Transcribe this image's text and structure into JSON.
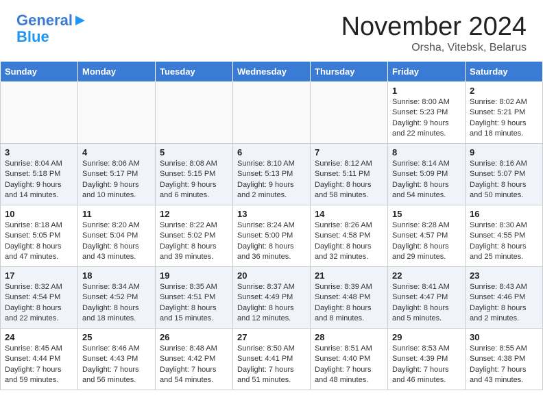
{
  "header": {
    "logo_line1": "General",
    "logo_line2": "Blue",
    "month_title": "November 2024",
    "location": "Orsha, Vitebsk, Belarus"
  },
  "weekdays": [
    "Sunday",
    "Monday",
    "Tuesday",
    "Wednesday",
    "Thursday",
    "Friday",
    "Saturday"
  ],
  "weeks": [
    [
      {
        "day": "",
        "info": ""
      },
      {
        "day": "",
        "info": ""
      },
      {
        "day": "",
        "info": ""
      },
      {
        "day": "",
        "info": ""
      },
      {
        "day": "",
        "info": ""
      },
      {
        "day": "1",
        "info": "Sunrise: 8:00 AM\nSunset: 5:23 PM\nDaylight: 9 hours\nand 22 minutes."
      },
      {
        "day": "2",
        "info": "Sunrise: 8:02 AM\nSunset: 5:21 PM\nDaylight: 9 hours\nand 18 minutes."
      }
    ],
    [
      {
        "day": "3",
        "info": "Sunrise: 8:04 AM\nSunset: 5:18 PM\nDaylight: 9 hours\nand 14 minutes."
      },
      {
        "day": "4",
        "info": "Sunrise: 8:06 AM\nSunset: 5:17 PM\nDaylight: 9 hours\nand 10 minutes."
      },
      {
        "day": "5",
        "info": "Sunrise: 8:08 AM\nSunset: 5:15 PM\nDaylight: 9 hours\nand 6 minutes."
      },
      {
        "day": "6",
        "info": "Sunrise: 8:10 AM\nSunset: 5:13 PM\nDaylight: 9 hours\nand 2 minutes."
      },
      {
        "day": "7",
        "info": "Sunrise: 8:12 AM\nSunset: 5:11 PM\nDaylight: 8 hours\nand 58 minutes."
      },
      {
        "day": "8",
        "info": "Sunrise: 8:14 AM\nSunset: 5:09 PM\nDaylight: 8 hours\nand 54 minutes."
      },
      {
        "day": "9",
        "info": "Sunrise: 8:16 AM\nSunset: 5:07 PM\nDaylight: 8 hours\nand 50 minutes."
      }
    ],
    [
      {
        "day": "10",
        "info": "Sunrise: 8:18 AM\nSunset: 5:05 PM\nDaylight: 8 hours\nand 47 minutes."
      },
      {
        "day": "11",
        "info": "Sunrise: 8:20 AM\nSunset: 5:04 PM\nDaylight: 8 hours\nand 43 minutes."
      },
      {
        "day": "12",
        "info": "Sunrise: 8:22 AM\nSunset: 5:02 PM\nDaylight: 8 hours\nand 39 minutes."
      },
      {
        "day": "13",
        "info": "Sunrise: 8:24 AM\nSunset: 5:00 PM\nDaylight: 8 hours\nand 36 minutes."
      },
      {
        "day": "14",
        "info": "Sunrise: 8:26 AM\nSunset: 4:58 PM\nDaylight: 8 hours\nand 32 minutes."
      },
      {
        "day": "15",
        "info": "Sunrise: 8:28 AM\nSunset: 4:57 PM\nDaylight: 8 hours\nand 29 minutes."
      },
      {
        "day": "16",
        "info": "Sunrise: 8:30 AM\nSunset: 4:55 PM\nDaylight: 8 hours\nand 25 minutes."
      }
    ],
    [
      {
        "day": "17",
        "info": "Sunrise: 8:32 AM\nSunset: 4:54 PM\nDaylight: 8 hours\nand 22 minutes."
      },
      {
        "day": "18",
        "info": "Sunrise: 8:34 AM\nSunset: 4:52 PM\nDaylight: 8 hours\nand 18 minutes."
      },
      {
        "day": "19",
        "info": "Sunrise: 8:35 AM\nSunset: 4:51 PM\nDaylight: 8 hours\nand 15 minutes."
      },
      {
        "day": "20",
        "info": "Sunrise: 8:37 AM\nSunset: 4:49 PM\nDaylight: 8 hours\nand 12 minutes."
      },
      {
        "day": "21",
        "info": "Sunrise: 8:39 AM\nSunset: 4:48 PM\nDaylight: 8 hours\nand 8 minutes."
      },
      {
        "day": "22",
        "info": "Sunrise: 8:41 AM\nSunset: 4:47 PM\nDaylight: 8 hours\nand 5 minutes."
      },
      {
        "day": "23",
        "info": "Sunrise: 8:43 AM\nSunset: 4:46 PM\nDaylight: 8 hours\nand 2 minutes."
      }
    ],
    [
      {
        "day": "24",
        "info": "Sunrise: 8:45 AM\nSunset: 4:44 PM\nDaylight: 7 hours\nand 59 minutes."
      },
      {
        "day": "25",
        "info": "Sunrise: 8:46 AM\nSunset: 4:43 PM\nDaylight: 7 hours\nand 56 minutes."
      },
      {
        "day": "26",
        "info": "Sunrise: 8:48 AM\nSunset: 4:42 PM\nDaylight: 7 hours\nand 54 minutes."
      },
      {
        "day": "27",
        "info": "Sunrise: 8:50 AM\nSunset: 4:41 PM\nDaylight: 7 hours\nand 51 minutes."
      },
      {
        "day": "28",
        "info": "Sunrise: 8:51 AM\nSunset: 4:40 PM\nDaylight: 7 hours\nand 48 minutes."
      },
      {
        "day": "29",
        "info": "Sunrise: 8:53 AM\nSunset: 4:39 PM\nDaylight: 7 hours\nand 46 minutes."
      },
      {
        "day": "30",
        "info": "Sunrise: 8:55 AM\nSunset: 4:38 PM\nDaylight: 7 hours\nand 43 minutes."
      }
    ]
  ]
}
